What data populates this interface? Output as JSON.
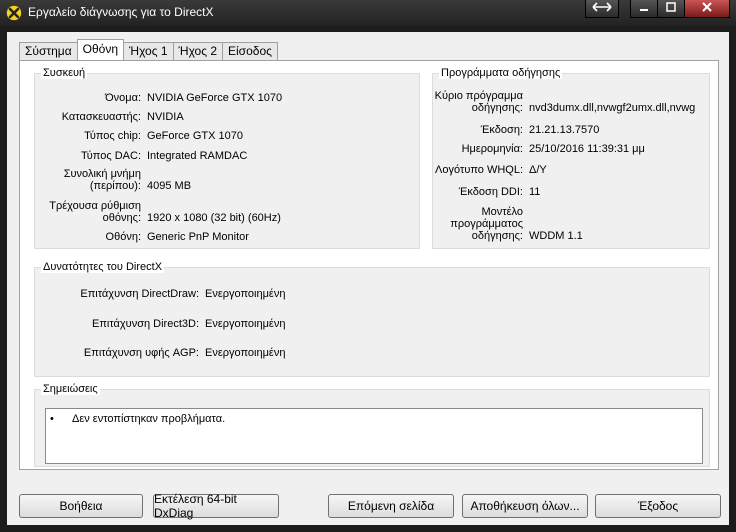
{
  "window": {
    "title": "Εργαλείο διάγνωσης για το DirectX",
    "icon": "directx-x-icon"
  },
  "tabs": [
    {
      "label": "Σύστημα",
      "active": false
    },
    {
      "label": "Οθόνη",
      "active": true
    },
    {
      "label": "Ήχος 1",
      "active": false
    },
    {
      "label": "Ήχος 2",
      "active": false
    },
    {
      "label": "Είσοδος",
      "active": false
    }
  ],
  "device": {
    "legend": "Συσκευή",
    "rows": [
      {
        "label": "Όνομα:",
        "value": "NVIDIA GeForce GTX 1070"
      },
      {
        "label": "Κατασκευαστής:",
        "value": "NVIDIA"
      },
      {
        "label": "Τύπος chip:",
        "value": "GeForce GTX 1070"
      },
      {
        "label": "Τύπος DAC:",
        "value": "Integrated RAMDAC"
      },
      {
        "label": "Συνολική μνήμη (περίπου):",
        "value": "4095 MB"
      },
      {
        "label": "Τρέχουσα ρύθμιση οθόνης:",
        "value": "1920 x 1080 (32 bit) (60Hz)"
      },
      {
        "label": "Οθόνη:",
        "value": "Generic PnP Monitor"
      }
    ]
  },
  "drivers": {
    "legend": "Προγράμματα οδήγησης",
    "rows": [
      {
        "label": "Κύριο πρόγραμμα οδήγησης:",
        "value": "nvd3dumx.dll,nvwgf2umx.dll,nvwg"
      },
      {
        "label": "Έκδοση:",
        "value": "21.21.13.7570"
      },
      {
        "label": "Ημερομηνία:",
        "value": "25/10/2016 11:39:31 μμ"
      },
      {
        "label": "Λογότυπο WHQL:",
        "value": "Δ/Υ"
      },
      {
        "label": "Έκδοση DDI:",
        "value": "11"
      },
      {
        "label": "Μοντέλο προγράμματος οδήγησης:",
        "value": "WDDM 1.1"
      }
    ]
  },
  "directx": {
    "legend": "Δυνατότητες του DirectX",
    "rows": [
      {
        "label": "Επιτάχυνση DirectDraw:",
        "value": "Ενεργοποιημένη"
      },
      {
        "label": "Επιτάχυνση Direct3D:",
        "value": "Ενεργοποιημένη"
      },
      {
        "label": "Επιτάχυνση υφής AGP:",
        "value": "Ενεργοποιημένη"
      }
    ]
  },
  "notes": {
    "legend": "Σημειώσεις",
    "items": [
      "Δεν εντοπίστηκαν προβλήματα."
    ]
  },
  "buttons": {
    "help": "Βοήθεια",
    "run64": "Εκτέλεση 64-bit DxDiag",
    "next": "Επόμενη σελίδα",
    "save": "Αποθήκευση όλων...",
    "exit": "Έξοδος"
  }
}
